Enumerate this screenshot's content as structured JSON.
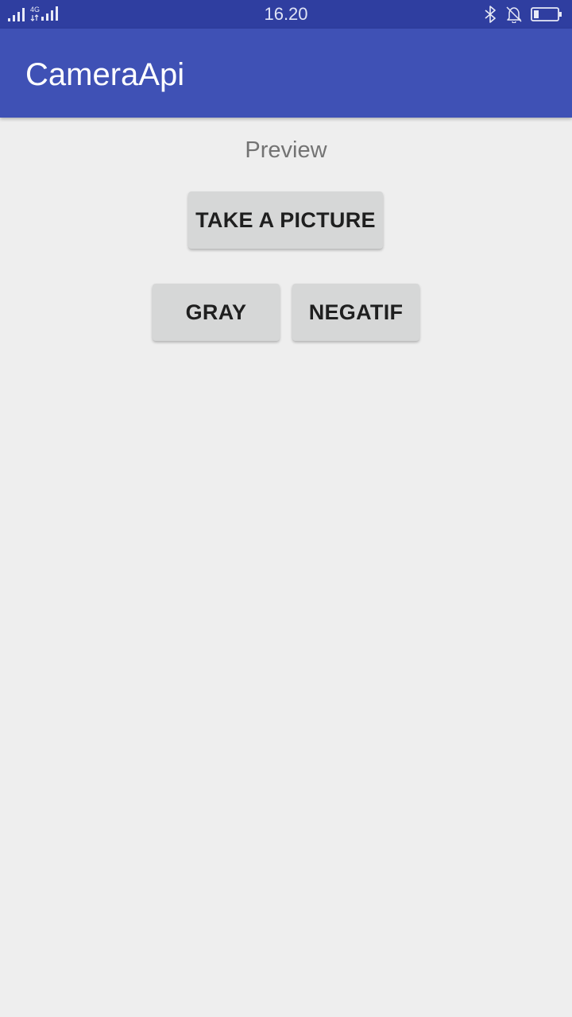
{
  "status_bar": {
    "time": "16.20",
    "network_type": "4G",
    "icons": [
      "signal-icon",
      "signal-4g-icon",
      "bluetooth-icon",
      "notifications-off-icon",
      "battery-icon"
    ],
    "battery_level": 0.2
  },
  "app_bar": {
    "title": "CameraApi",
    "color": "#3f51b5"
  },
  "main": {
    "preview_label": "Preview",
    "take_picture_label": "TAKE A PICTURE",
    "gray_label": "GRAY",
    "negatif_label": "NEGATIF"
  },
  "colors": {
    "status_bar": "#2f3ea0",
    "background": "#eeeeee",
    "button": "#d6d7d7"
  }
}
